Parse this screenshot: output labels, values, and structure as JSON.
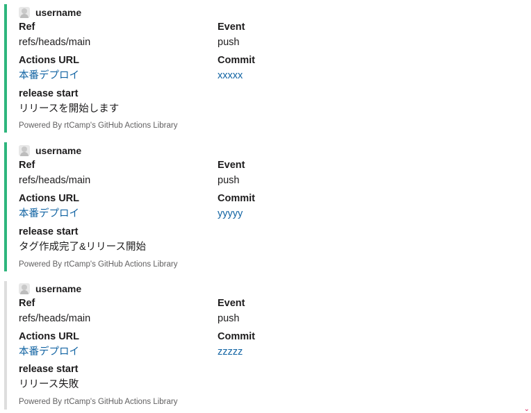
{
  "messages": [
    {
      "author": "username",
      "ref_title": "Ref",
      "ref_value": "refs/heads/main",
      "event_title": "Event",
      "event_value": "push",
      "actions_title": "Actions URL",
      "actions_value": "本番デプロイ",
      "commit_title": "Commit",
      "commit_value": "xxxxx",
      "release_title": "release start",
      "release_value": "リリースを開始します",
      "footer": "Powered By rtCamp's GitHub Actions Library",
      "color": "#2eb67d"
    },
    {
      "author": "username",
      "ref_title": "Ref",
      "ref_value": "refs/heads/main",
      "event_title": "Event",
      "event_value": "push",
      "actions_title": "Actions URL",
      "actions_value": "本番デプロイ",
      "commit_title": "Commit",
      "commit_value": "yyyyy",
      "release_title": "release start",
      "release_value": "タグ作成完了&リリース開始",
      "footer": "Powered By rtCamp's GitHub Actions Library",
      "color": "#2eb67d"
    },
    {
      "author": "username",
      "ref_title": "Ref",
      "ref_value": "refs/heads/main",
      "event_title": "Event",
      "event_value": "push",
      "actions_title": "Actions URL",
      "actions_value": "本番デプロイ",
      "commit_title": "Commit",
      "commit_value": "zzzzz",
      "release_title": "release start",
      "release_value": "リリース失敗",
      "footer": "Powered By rtCamp's GitHub Actions Library",
      "color": "#dddddd"
    }
  ],
  "link_color": "#1264a3",
  "avatar_icon": "user-avatar-icon"
}
